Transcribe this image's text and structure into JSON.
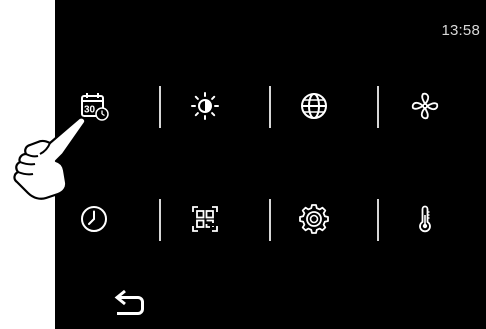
{
  "status_bar": {
    "time": "13:58"
  },
  "menu": {
    "items": [
      {
        "name": "calendar-date-settings",
        "icon": "calendar-clock-icon",
        "calendar_day": "30"
      },
      {
        "name": "brightness-settings",
        "icon": "brightness-icon"
      },
      {
        "name": "language-settings",
        "icon": "globe-icon"
      },
      {
        "name": "fan-settings",
        "icon": "fan-icon"
      },
      {
        "name": "clock-settings",
        "icon": "clock-icon"
      },
      {
        "name": "qr-code",
        "icon": "qr-code-icon"
      },
      {
        "name": "general-settings",
        "icon": "gear-icon"
      },
      {
        "name": "temperature-settings",
        "icon": "thermometer-icon"
      }
    ]
  },
  "navigation": {
    "back_icon": "back-arrow-icon"
  },
  "overlay": {
    "pointer_icon": "pointing-hand-icon"
  },
  "colors": {
    "background": "#000000",
    "icon": "#ffffff",
    "divider": "#d6d6d6",
    "text": "#d8d8d8"
  }
}
